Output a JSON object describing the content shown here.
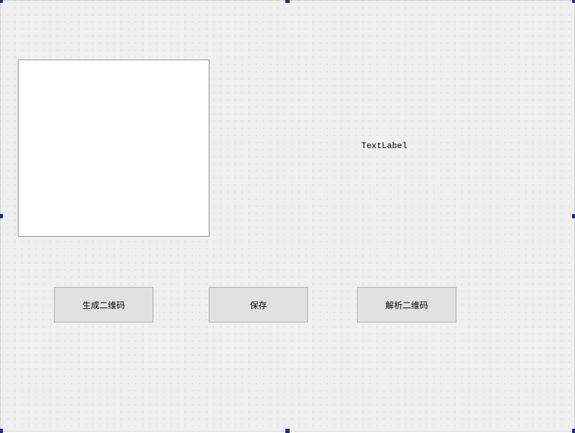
{
  "label": {
    "text": "TextLabel"
  },
  "buttons": {
    "generate": "生成二维码",
    "save": "保存",
    "parse": "解析二维码"
  }
}
